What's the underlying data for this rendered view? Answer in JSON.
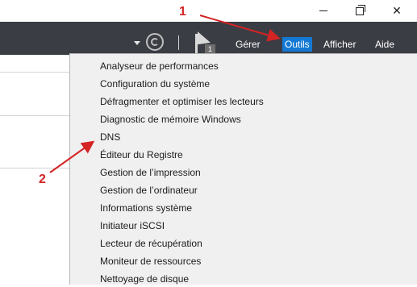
{
  "window": {
    "minimize_icon": "minimize-icon",
    "maximize_icon": "restore-icon",
    "close_icon": "close-icon",
    "close_glyph": "✕"
  },
  "toolbar": {
    "flag_badge": "1"
  },
  "menubar": {
    "items": [
      "Gérer",
      "Outils",
      "Afficher",
      "Aide"
    ],
    "active": "Outils",
    "active_color": "#1479d4",
    "bar_color": "#3b3d44"
  },
  "tools_menu": {
    "items": [
      "Analyseur de performances",
      "Configuration du système",
      "Défragmenter et optimiser les lecteurs",
      "Diagnostic de mémoire Windows",
      "DNS",
      "Éditeur du Registre",
      "Gestion de l’impression",
      "Gestion de l’ordinateur",
      "Informations système",
      "Initiateur iSCSI",
      "Lecteur de récupération",
      "Moniteur de ressources",
      "Nettoyage de disque"
    ]
  },
  "annotations": {
    "callout_1": "1",
    "callout_2": "2",
    "color": "#d42424"
  }
}
